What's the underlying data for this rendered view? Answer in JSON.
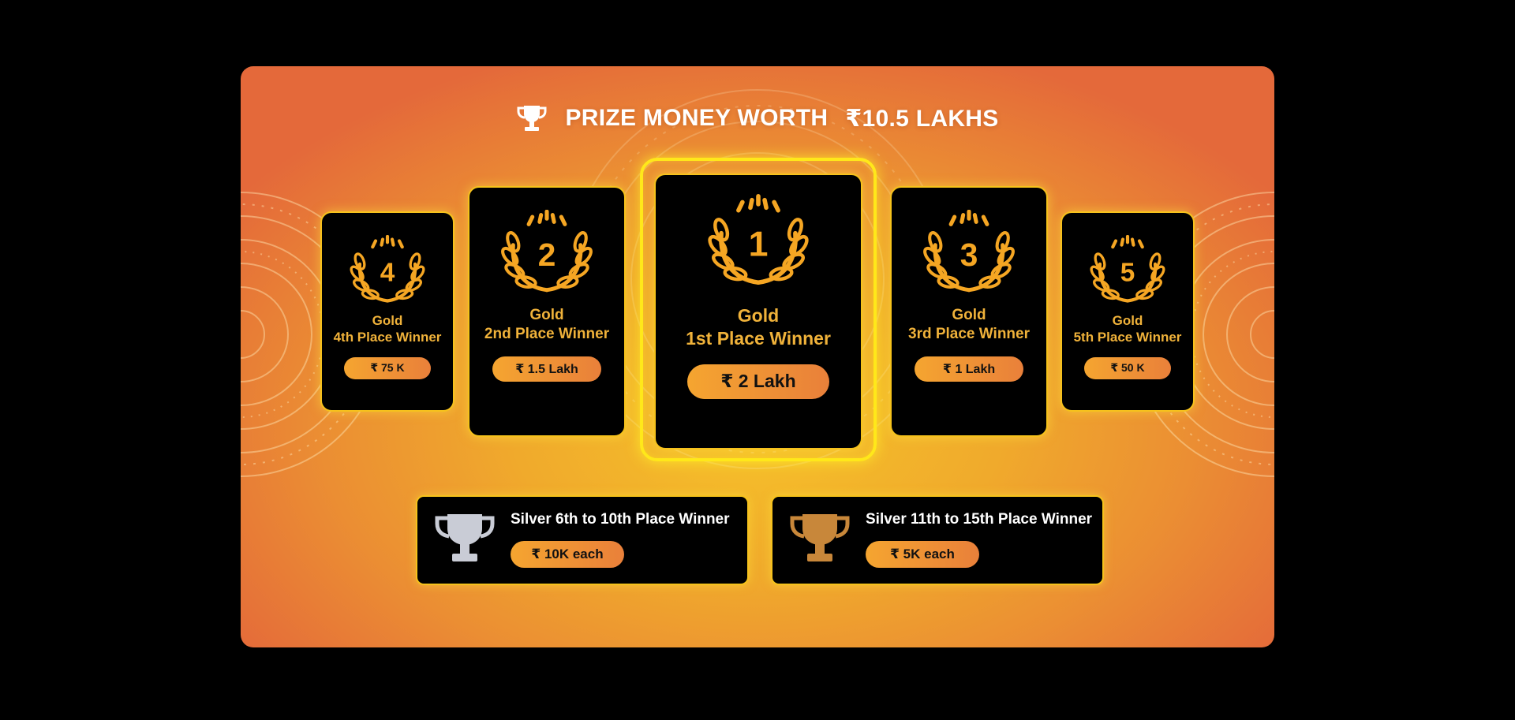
{
  "title": {
    "text": "PRIZE MONEY WORTH",
    "amount": "₹10.5 LAKHS",
    "icon": "trophy-icon"
  },
  "cards": [
    {
      "rank": "4",
      "tier": "Gold",
      "place": "4th Place Winner",
      "prize": "₹ 75 K"
    },
    {
      "rank": "2",
      "tier": "Gold",
      "place": "2nd Place Winner",
      "prize": "₹ 1.5 Lakh"
    },
    {
      "rank": "1",
      "tier": "Gold",
      "place": "1st Place Winner",
      "prize": "₹ 2 Lakh"
    },
    {
      "rank": "3",
      "tier": "Gold",
      "place": "3rd Place Winner",
      "prize": "₹ 1 Lakh"
    },
    {
      "rank": "5",
      "tier": "Gold",
      "place": "5th Place Winner",
      "prize": "₹ 50 K"
    }
  ],
  "silver_tiers": [
    {
      "label": "Silver 6th to 10th Place Winner",
      "prize": "₹ 10K each",
      "icon": "silver-trophy-icon",
      "color": "#c9ccd6"
    },
    {
      "label": "Silver 11th to 15th Place Winner",
      "prize": "₹ 5K each",
      "icon": "bronze-trophy-icon",
      "color": "#c8873a"
    }
  ],
  "colors": {
    "gold_text": "#f0b23a",
    "laurel": "#f5a623",
    "highlight": "#ffe81a",
    "pill_start": "#f5a530",
    "pill_end": "#e9803a"
  }
}
